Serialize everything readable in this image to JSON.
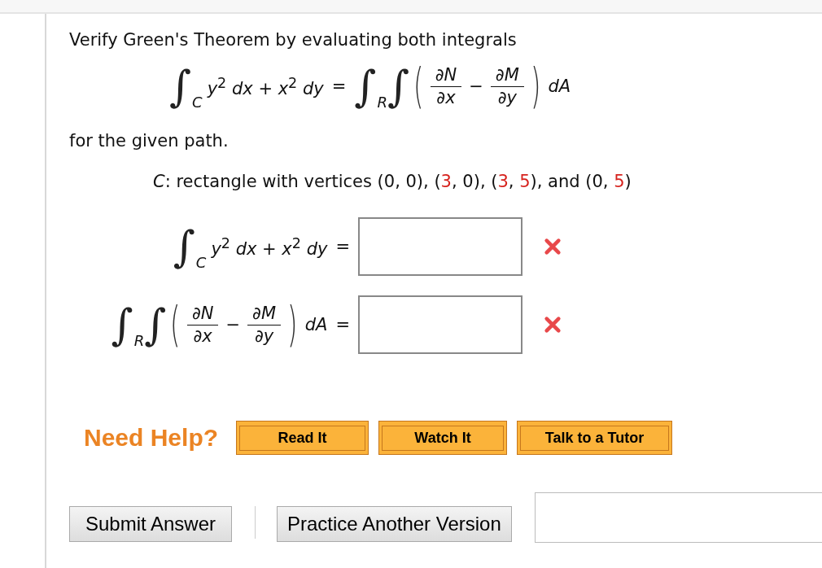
{
  "prompt": "Verify Green's Theorem by evaluating both integrals",
  "equation": {
    "line": {
      "sign": "∫",
      "sub": "C",
      "integrand": "*y*$^{2}$ *dx* + *x*$^{2}$ *dy*"
    },
    "equals": "=",
    "double": {
      "signs": [
        "∫",
        "∫"
      ],
      "sub": "R",
      "open": "(",
      "close": ")",
      "fractions": [
        {
          "num": "∂N",
          "den": "∂x"
        },
        {
          "num": "∂M",
          "den": "∂y"
        }
      ],
      "minus": "−",
      "tail": "dA"
    }
  },
  "path_intro": "for the given path.",
  "path": [
    {
      "text": "*C*: rectangle with vertices (0, 0), (",
      "highlight": false
    },
    {
      "text": "3",
      "highlight": true
    },
    {
      "text": ", 0), (",
      "highlight": false
    },
    {
      "text": "3",
      "highlight": true
    },
    {
      "text": ", ",
      "highlight": false
    },
    {
      "text": "5",
      "highlight": true
    },
    {
      "text": "), and (0, ",
      "highlight": false
    },
    {
      "text": "5",
      "highlight": true
    },
    {
      "text": ")",
      "highlight": false
    }
  ],
  "answers": [
    {
      "kind": "line",
      "lhs": {
        "sign": "∫",
        "sub": "C",
        "integrand": "*y*$^{2}$ *dx* + *x*$^{2}$ *dy*"
      },
      "equals": "=",
      "correct": false
    },
    {
      "kind": "double",
      "lhs": {
        "signs": [
          "∫",
          "∫"
        ],
        "sub": "R",
        "open": "(",
        "close": ")",
        "fractions": [
          {
            "num": "∂N",
            "den": "∂x"
          },
          {
            "num": "∂M",
            "den": "∂y"
          }
        ],
        "minus": "−",
        "tail": "dA"
      },
      "equals": "=",
      "correct": false
    }
  ],
  "help": {
    "label": "Need Help?",
    "buttons": [
      "Read It",
      "Watch It",
      "Talk to a Tutor"
    ]
  },
  "actions": [
    "Submit Answer",
    "Practice Another Version"
  ]
}
